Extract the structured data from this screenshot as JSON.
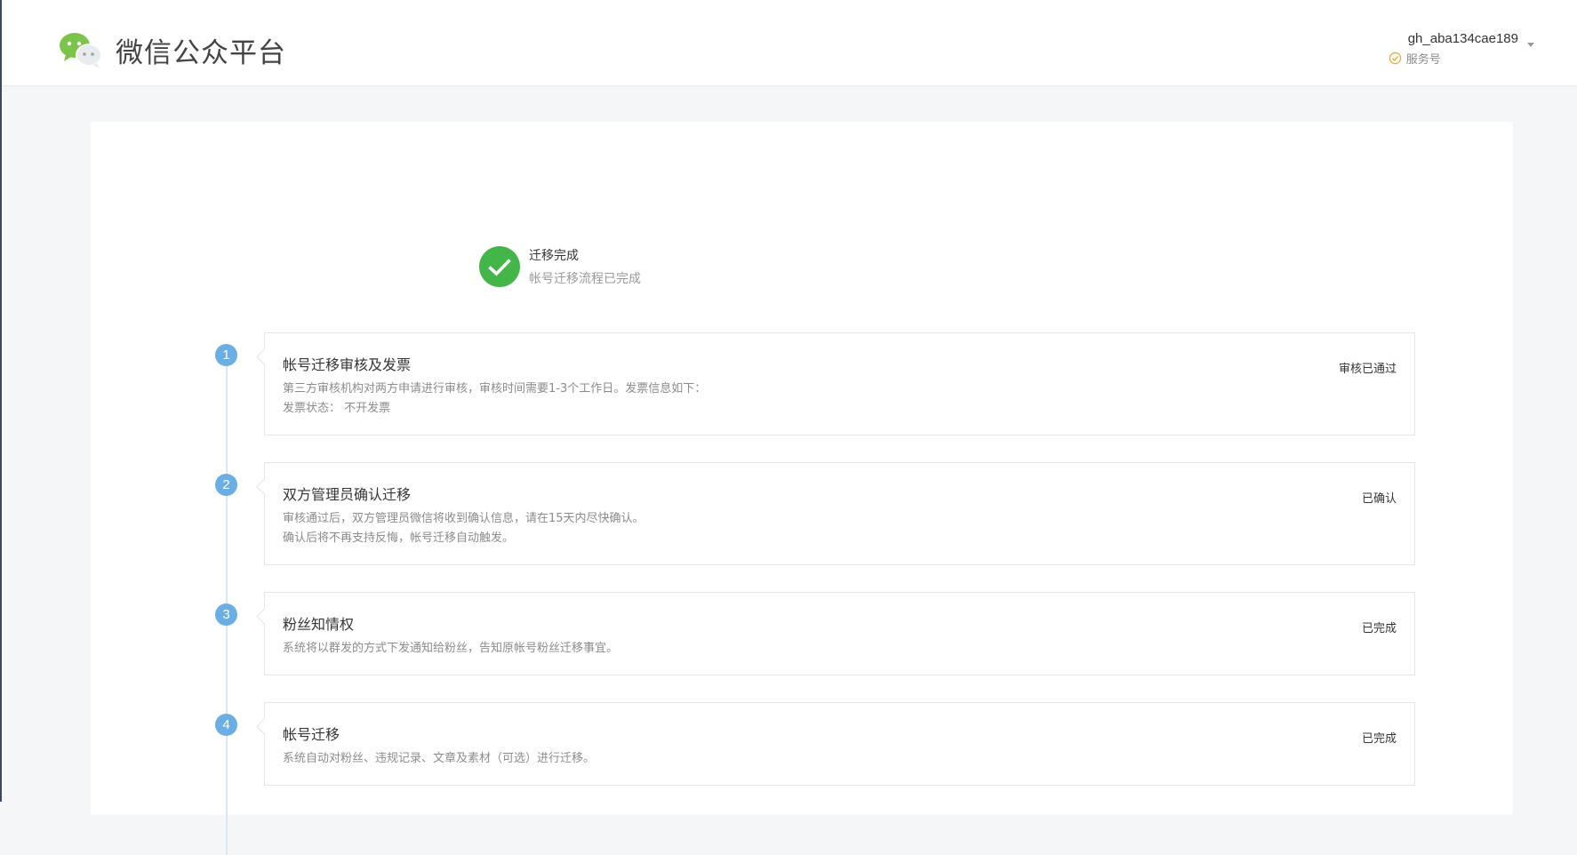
{
  "header": {
    "logo_text": "微信公众平台",
    "account_name": "gh_aba134cae189",
    "account_type": "服务号"
  },
  "status": {
    "title": "迁移完成",
    "desc": "帐号迁移流程已完成"
  },
  "steps": [
    {
      "num": "1",
      "title": "帐号迁移审核及发票",
      "desc_lines": [
        "第三方审核机构对两方申请进行审核，审核时间需要1-3个工作日。发票信息如下：",
        "发票状态：  不开发票"
      ],
      "status": "审核已通过"
    },
    {
      "num": "2",
      "title": "双方管理员确认迁移",
      "desc_lines": [
        "审核通过后，双方管理员微信将收到确认信息，请在15天内尽快确认。",
        "确认后将不再支持反悔，帐号迁移自动触发。"
      ],
      "status": "已确认"
    },
    {
      "num": "3",
      "title": "粉丝知情权",
      "desc_lines": [
        "系统将以群发的方式下发通知给粉丝，告知原帐号粉丝迁移事宜。"
      ],
      "status": "已完成"
    },
    {
      "num": "4",
      "title": "帐号迁移",
      "desc_lines": [
        "系统自动对粉丝、违规记录、文章及素材（可选）进行迁移。"
      ],
      "status": "已完成"
    }
  ],
  "colors": {
    "success_green": "#44b549",
    "step_blue": "#6aaee3",
    "verified_orange": "#f0a830"
  },
  "icons": {
    "logo": "wechat-logo-icon",
    "verified": "verified-check-icon",
    "dropdown": "caret-down-icon",
    "success": "success-check-icon"
  }
}
